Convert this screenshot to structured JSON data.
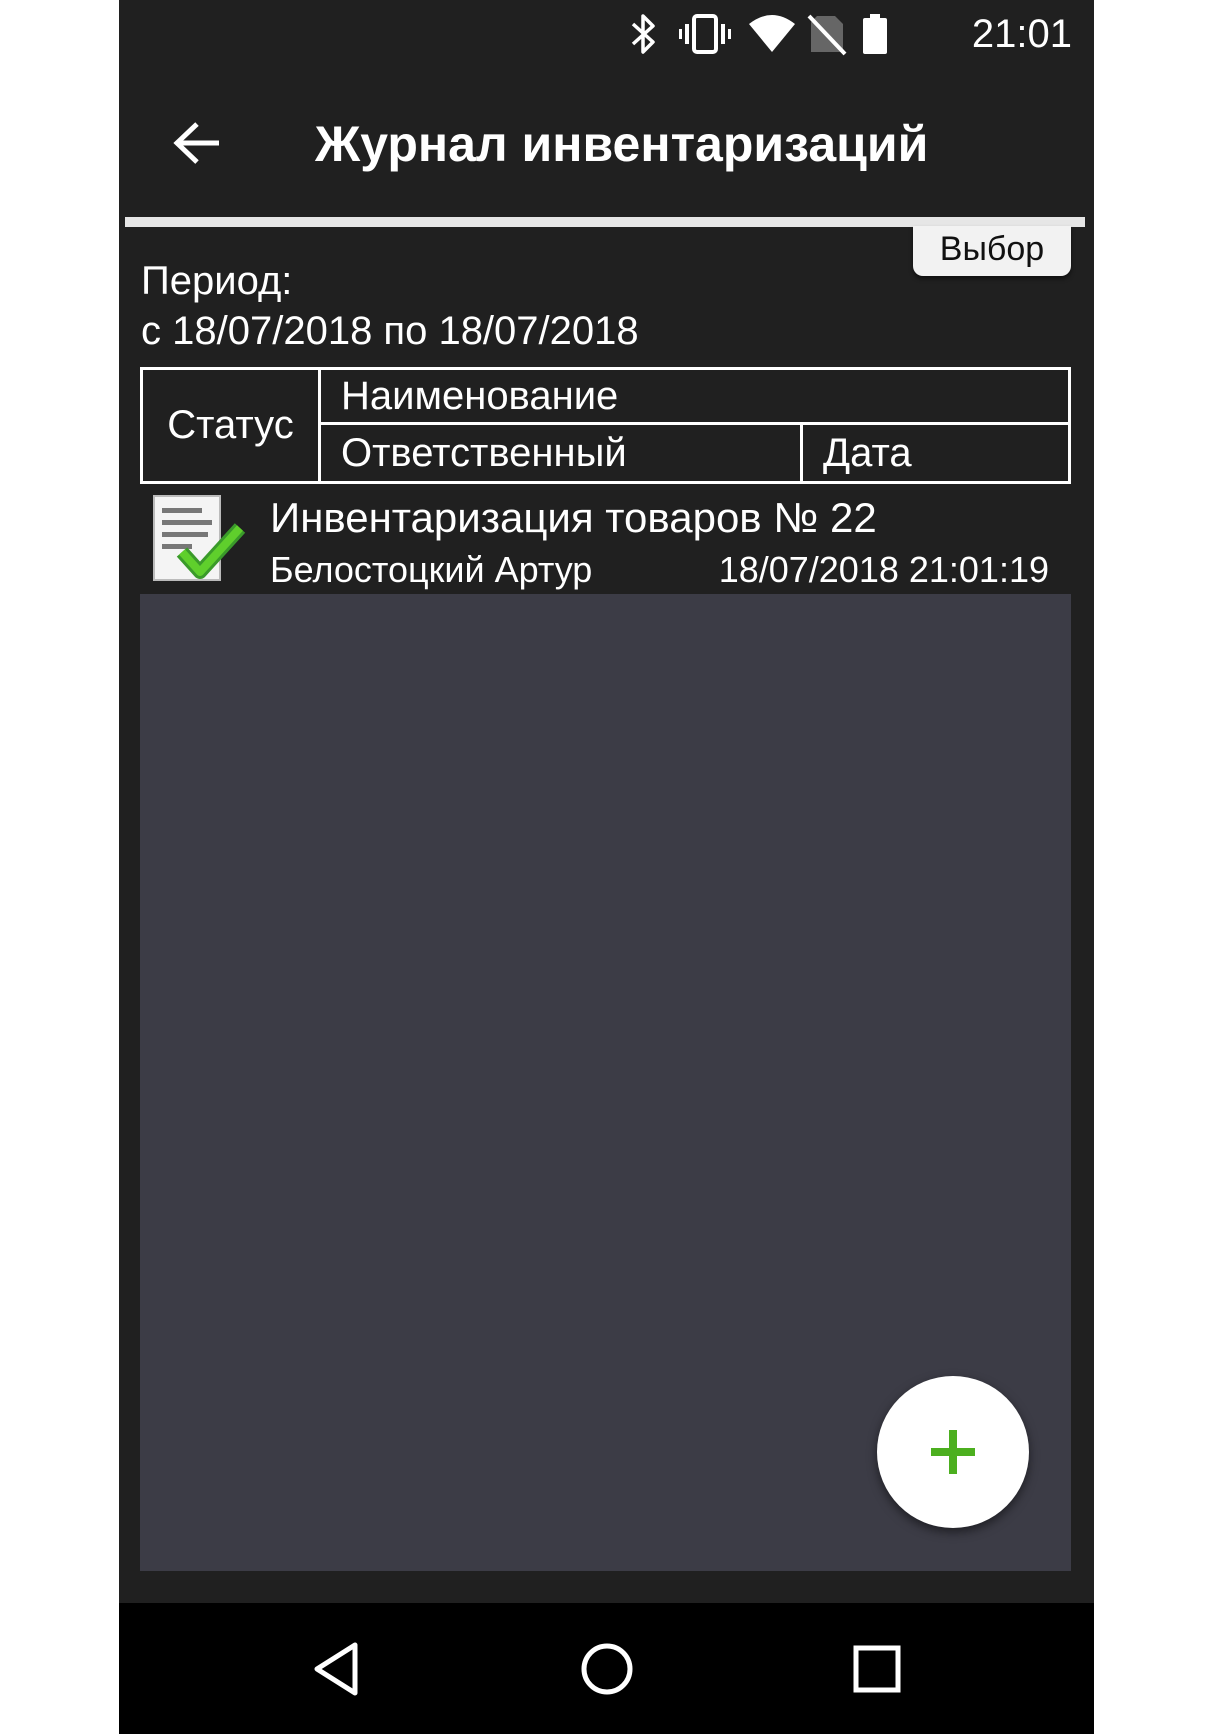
{
  "status_bar": {
    "time": "21:01",
    "icons": [
      "bluetooth-icon",
      "vibrate-icon",
      "wifi-icon",
      "no-sim-icon",
      "battery-icon"
    ]
  },
  "app_bar": {
    "title": "Журнал инвентаризаций",
    "back_icon": "arrow-left-icon"
  },
  "filter": {
    "select_label": "Выбор",
    "period_label": "Период:",
    "period_range": "с 18/07/2018 по 18/07/2018"
  },
  "table_header": {
    "status": "Статус",
    "name": "Наименование",
    "responsible": "Ответственный",
    "date": "Дата"
  },
  "items": [
    {
      "name": "Инвентаризация товаров № 22",
      "responsible": "Белостоцкий Артур",
      "date": "18/07/2018 21:01:19",
      "status_icon": "document-check-icon"
    }
  ],
  "fab": {
    "icon": "plus-icon",
    "color": "#4caf1f"
  },
  "nav_bar": {
    "icons": [
      "back-triangle-icon",
      "home-circle-icon",
      "recents-square-icon"
    ]
  },
  "colors": {
    "background": "#202020",
    "list_area": "#3c3c46",
    "accent_green": "#4caf1f"
  }
}
